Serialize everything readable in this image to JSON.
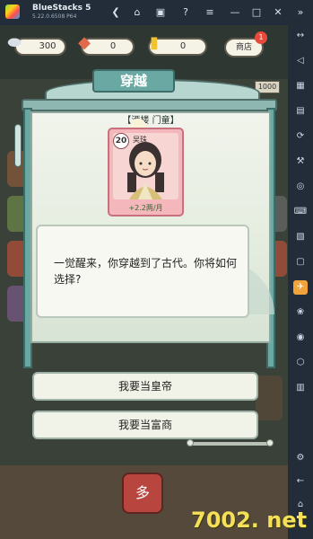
{
  "window": {
    "app_name": "BlueStacks 5",
    "version": "5.22.0.6508  P64"
  },
  "titlebar_icons": [
    "back-icon",
    "home-icon",
    "layers-icon",
    "help-icon",
    "menu-icon",
    "minimize-icon",
    "maximize-icon",
    "close-icon"
  ],
  "sidebar_icons": [
    "collapse-icon",
    "expand-icon",
    "volume-icon",
    "record-icon",
    "screenshot-icon",
    "gamepad-icon",
    "camera-icon",
    "keyboard-icon",
    "install-apk-icon",
    "folder-icon",
    "airplane-icon",
    "rotate-icon",
    "location-icon",
    "layers-icon",
    "macro-icon",
    "settings-icon",
    "back-icon",
    "home-icon"
  ],
  "resources": {
    "silver": "300",
    "tickets": "0",
    "gold": "0"
  },
  "shop": {
    "label": "商店",
    "badge": "1"
  },
  "modal": {
    "title": "穿越",
    "location": "【酒楼 门童】",
    "character": {
      "level": "20",
      "name": "吴珠",
      "income": "+2.2两/月"
    },
    "dialog_text": "一觉醒来，你穿越到了古代。你将如何选择?",
    "choices": [
      "我要当皇帝",
      "我要当富商"
    ]
  },
  "background": {
    "sign_value": "1000"
  },
  "bottom_button_label": "多",
  "watermark": "7002. net",
  "colors": {
    "accent_teal": "#6aa9a3",
    "card_pink": "#f3b7bc",
    "badge_red": "#e64a3b",
    "income_green": "#2b6a2d"
  }
}
